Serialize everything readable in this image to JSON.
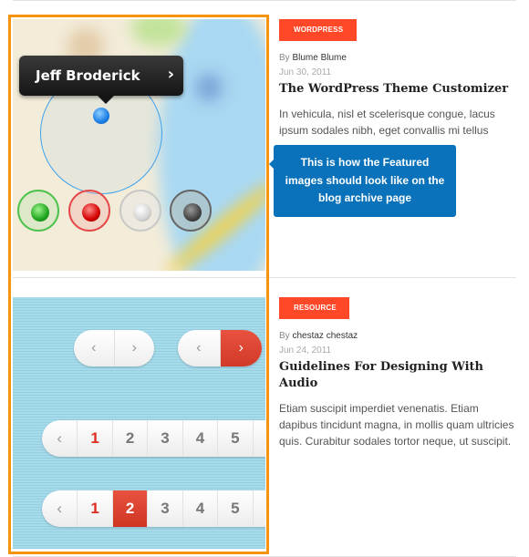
{
  "posts": [
    {
      "category": "WORDPRESS",
      "by_label": "By",
      "author": "Blume Blume",
      "date": "Jun 30, 2011",
      "title": "The WordPress Theme Customizer",
      "excerpt": "In vehicula, nisl et scelerisque congue, lacus ipsum sodales nibh, eget convallis mi tellus",
      "thumbnail": {
        "callout_name": "Jeff Broderick",
        "callout_chevron": "›"
      }
    },
    {
      "category": "RESOURCE",
      "by_label": "By",
      "author": "chestaz chestaz",
      "date": "Jun 24, 2011",
      "title": "Guidelines For Designing With Audio",
      "excerpt": "Etiam suscipit imperdiet venenatis. Etiam dapibus tincidunt magna, in mollis quam ultricies quis. Curabitur sodales tortor neque, ut suscipit.",
      "thumbnail": {
        "prev_glyph": "‹",
        "next_glyph": "›",
        "pages": [
          "1",
          "2",
          "3",
          "4",
          "5"
        ],
        "pager1_active": "1",
        "pager2_active": "2"
      }
    }
  ],
  "tooltip": {
    "text": "This is how the Featured images should look like on the blog archive page"
  },
  "colors": {
    "badge": "#ff4828",
    "highlight": "#f7940d",
    "tooltip": "#0a72bb"
  }
}
